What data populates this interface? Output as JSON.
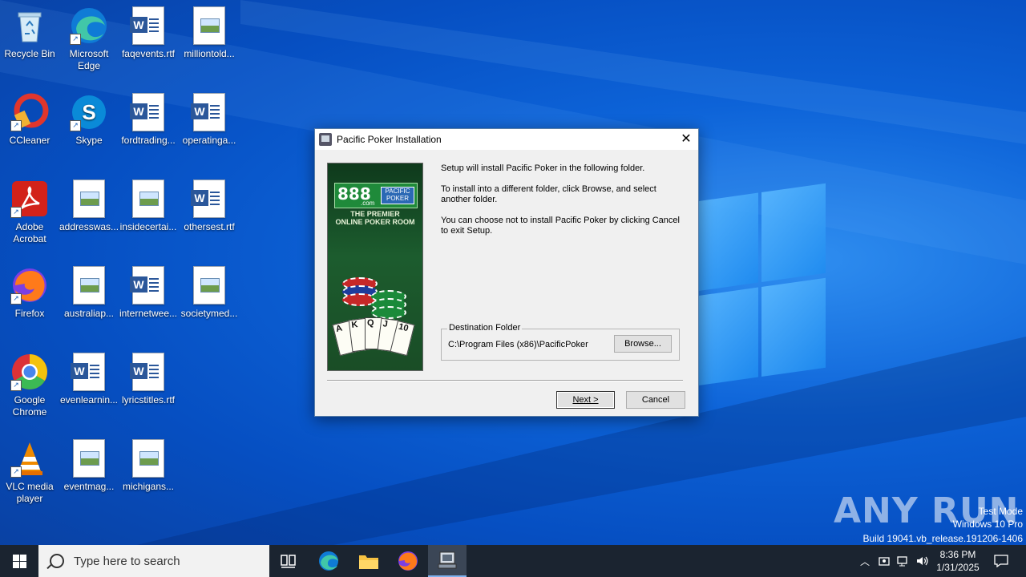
{
  "desktop": {
    "icons": [
      {
        "label": "Recycle Bin",
        "icon": "recycle-bin-icon"
      },
      {
        "label": "Microsoft Edge",
        "icon": "edge-icon"
      },
      {
        "label": "faqevents.rtf",
        "icon": "word-document-icon"
      },
      {
        "label": "milliontold...",
        "icon": "image-document-icon"
      },
      {
        "label": "CCleaner",
        "icon": "ccleaner-icon"
      },
      {
        "label": "Skype",
        "icon": "skype-icon"
      },
      {
        "label": "fordtrading...",
        "icon": "word-document-icon"
      },
      {
        "label": "operatinga...",
        "icon": "word-document-icon"
      },
      {
        "label": "Adobe Acrobat",
        "icon": "acrobat-icon"
      },
      {
        "label": "addresswas...",
        "icon": "image-document-icon"
      },
      {
        "label": "insidecertai...",
        "icon": "image-document-icon"
      },
      {
        "label": "othersest.rtf",
        "icon": "word-document-icon"
      },
      {
        "label": "Firefox",
        "icon": "firefox-icon"
      },
      {
        "label": "australiap...",
        "icon": "image-document-icon"
      },
      {
        "label": "internetwee...",
        "icon": "word-document-icon"
      },
      {
        "label": "societymed...",
        "icon": "image-document-icon"
      },
      {
        "label": "Google Chrome",
        "icon": "chrome-icon"
      },
      {
        "label": "evenlearnin...",
        "icon": "word-document-icon"
      },
      {
        "label": "lyricstitles.rtf",
        "icon": "word-document-icon"
      },
      {
        "label": "VLC media player",
        "icon": "vlc-icon"
      },
      {
        "label": "eventmag...",
        "icon": "image-document-icon"
      },
      {
        "label": "michigans...",
        "icon": "image-document-icon"
      }
    ]
  },
  "dialog": {
    "title": "Pacific Poker Installation",
    "banner": {
      "logo_number": "888",
      "logo_com": ".com",
      "logo_badge": "PACIFIC POKER",
      "tagline_1": "THE PREMIER",
      "tagline_2": "ONLINE POKER ROOM",
      "cards": [
        "A",
        "K",
        "Q",
        "J",
        "10"
      ]
    },
    "text_1": "Setup will install Pacific Poker in the following folder.",
    "text_2": "To install into a different folder, click Browse, and select another folder.",
    "text_3": "You can choose not to install Pacific Poker by clicking Cancel to exit Setup.",
    "destination_label": "Destination Folder",
    "destination_path": "C:\\Program Files (x86)\\PacificPoker",
    "browse_label": "Browse...",
    "next_label": "Next >",
    "cancel_label": "Cancel"
  },
  "watermark": {
    "brand": "ANY RUN",
    "line_1": "Test Mode",
    "line_2": "Windows 10 Pro",
    "line_3": "Build 19041.vb_release.191206-1406"
  },
  "taskbar": {
    "search_placeholder": "Type here to search",
    "apps": [
      "task-view-icon",
      "edge-icon",
      "file-explorer-icon",
      "firefox-icon",
      "installer-icon"
    ],
    "time": "8:36 PM",
    "date": "1/31/2025"
  }
}
